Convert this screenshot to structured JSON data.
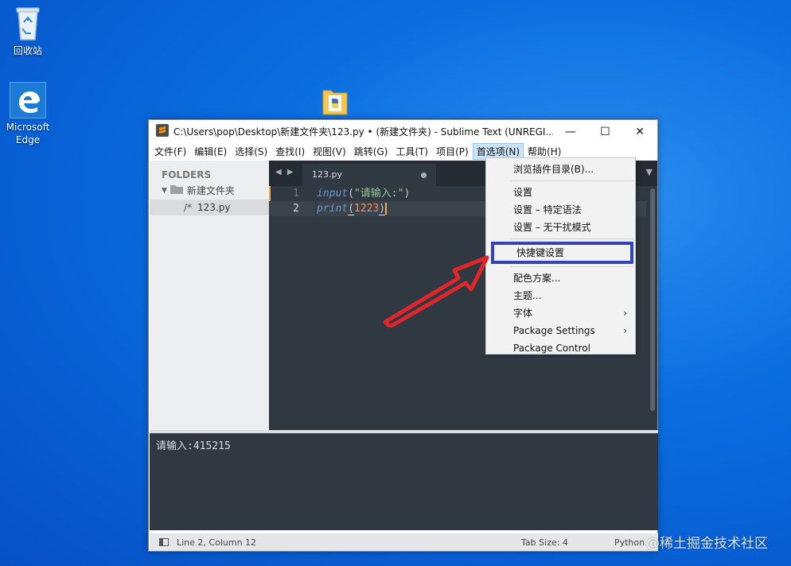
{
  "desktop": {
    "recycle_bin_label": "回收站",
    "edge_label": "Microsoft Edge",
    "folder_icon": "python-folder-icon"
  },
  "window": {
    "title": "C:\\Users\\pop\\Desktop\\新建文件夹\\123.py • (新建文件夹) - Sublime Text (UNREGI...",
    "minimize": "—",
    "maximize": "☐",
    "close": "✕"
  },
  "menubar": {
    "items": [
      "文件(F)",
      "编辑(E)",
      "选择(S)",
      "查找(I)",
      "视图(V)",
      "跳转(G)",
      "工具(T)",
      "项目(P)",
      "首选项(N)",
      "帮助(H)"
    ],
    "active": "首选项(N)"
  },
  "sidebar": {
    "header": "FOLDERS",
    "folder": "新建文件夹",
    "file_prefix": "/*",
    "file": "123.py"
  },
  "tab": {
    "label": "123.py",
    "nav": "◀ ▶",
    "dropdown": "▼"
  },
  "editor": {
    "line_numbers": [
      "1",
      "2"
    ],
    "line1": {
      "fn": "input",
      "open": "(",
      "str": "\"请输入:\"",
      "close": ")"
    },
    "line2": {
      "fn": "print",
      "open": "(",
      "num": "1223",
      "close": ")"
    }
  },
  "console": {
    "output": "请输入:415215"
  },
  "statusbar": {
    "position": "Line 2, Column 12",
    "tab_size": "Tab Size: 4",
    "syntax": "Python"
  },
  "dropdown": {
    "items": [
      {
        "label": "浏览插件目录(B)..."
      },
      {
        "label": "设置"
      },
      {
        "label": "设置 – 特定语法"
      },
      {
        "label": "设置 – 无干扰模式"
      },
      {
        "label": "快捷键设置",
        "highlighted": true
      },
      {
        "label": "配色方案..."
      },
      {
        "label": "主题..."
      },
      {
        "label": "字体",
        "submenu": "›"
      },
      {
        "label": "Package Settings",
        "submenu": "›"
      },
      {
        "label": "Package Control"
      }
    ]
  },
  "annotation": {
    "highlight_color": "#3344bb",
    "arrow_color": "#e0262b"
  },
  "watermark": "@稀土掘金技术社区"
}
